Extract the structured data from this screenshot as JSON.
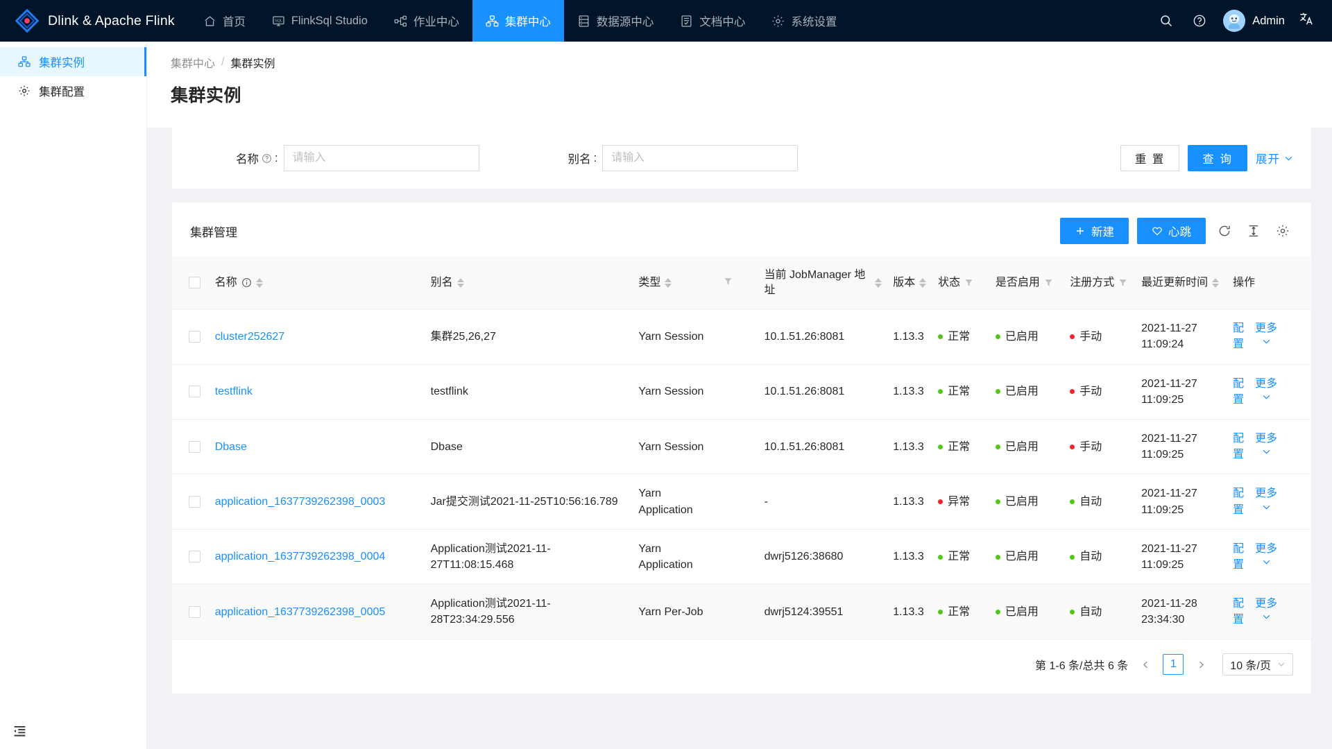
{
  "header": {
    "brand": "Dlink & Apache Flink",
    "logo_icon": "dlink-diamond-logo",
    "nav": [
      {
        "label": "首页",
        "icon": "home-icon",
        "active": false
      },
      {
        "label": "FlinkSql Studio",
        "icon": "sql-monitor-icon",
        "active": false
      },
      {
        "label": "作业中心",
        "icon": "job-node-icon",
        "active": false
      },
      {
        "label": "集群中心",
        "icon": "cluster-icon",
        "active": true
      },
      {
        "label": "数据源中心",
        "icon": "database-icon",
        "active": false
      },
      {
        "label": "文档中心",
        "icon": "document-icon",
        "active": false
      },
      {
        "label": "系统设置",
        "icon": "gear-icon",
        "active": false
      }
    ],
    "tools": [
      {
        "name": "search-icon"
      },
      {
        "name": "help-circle-icon"
      }
    ],
    "user": "Admin",
    "language_icon": "translate-icon",
    "accent": "#1890ff",
    "background": "#001529"
  },
  "sidebar": {
    "items": [
      {
        "label": "集群实例",
        "icon": "cluster-icon",
        "active": true
      },
      {
        "label": "集群配置",
        "icon": "gear-icon",
        "active": false
      }
    ],
    "collapse_icon": "menu-fold-icon"
  },
  "breadcrumb": {
    "root": "集群中心",
    "separator": "/",
    "current": "集群实例"
  },
  "page": {
    "title": "集群实例"
  },
  "filter": {
    "name_label": "名称",
    "name_help_icon": "question-circle-icon",
    "name_colon": ":",
    "name_value": "",
    "name_placeholder": "请输入",
    "alias_label": "别名",
    "alias_colon": ":",
    "alias_value": "",
    "alias_placeholder": "请输入",
    "reset_label": "重 置",
    "search_label": "查 询",
    "expand_label": "展开",
    "expand_icon": "chevron-down-icon"
  },
  "table": {
    "title": "集群管理",
    "toolbar": {
      "create_label": "新建",
      "create_icon": "plus-icon",
      "heartbeat_label": "心跳",
      "heartbeat_icon": "heart-icon",
      "refresh_icon": "reload-icon",
      "density_icon": "column-height-icon",
      "settings_icon": "gear-icon"
    },
    "columns": [
      {
        "key": "check",
        "label": "",
        "sortable": false,
        "filterable": false
      },
      {
        "key": "name",
        "label": "名称",
        "info_icon": "info-circle-icon",
        "sortable": true,
        "filterable": false
      },
      {
        "key": "alias",
        "label": "别名",
        "sortable": true,
        "filterable": false
      },
      {
        "key": "type",
        "label": "类型",
        "sortable": true,
        "filterable": true
      },
      {
        "key": "jm",
        "label": "当前 JobManager 地址",
        "sortable": true,
        "filterable": false
      },
      {
        "key": "ver",
        "label": "版本",
        "sortable": true,
        "filterable": false
      },
      {
        "key": "status",
        "label": "状态",
        "sortable": false,
        "filterable": true
      },
      {
        "key": "enable",
        "label": "是否启用",
        "sortable": false,
        "filterable": true
      },
      {
        "key": "reg",
        "label": "注册方式",
        "sortable": false,
        "filterable": true
      },
      {
        "key": "updated",
        "label": "最近更新时间",
        "sortable": true,
        "filterable": false
      },
      {
        "key": "ops",
        "label": "操作",
        "sortable": false,
        "filterable": false
      }
    ],
    "rows": [
      {
        "name": "cluster252627",
        "alias": "集群25,26,27",
        "type": "Yarn Session",
        "jm": "10.1.51.26:8081",
        "ver": "1.13.3",
        "status": "正常",
        "status_color": "#52c41a",
        "enable": "已启用",
        "enable_color": "#52c41a",
        "reg": "手动",
        "reg_color": "#f5222d",
        "updated_date": "2021-11-27",
        "updated_time": "11:09:24",
        "op_config": "配置",
        "op_more": "更多",
        "highlight": false
      },
      {
        "name": "testflink",
        "alias": "testflink",
        "type": "Yarn Session",
        "jm": "10.1.51.26:8081",
        "ver": "1.13.3",
        "status": "正常",
        "status_color": "#52c41a",
        "enable": "已启用",
        "enable_color": "#52c41a",
        "reg": "手动",
        "reg_color": "#f5222d",
        "updated_date": "2021-11-27",
        "updated_time": "11:09:25",
        "op_config": "配置",
        "op_more": "更多",
        "highlight": false
      },
      {
        "name": "Dbase",
        "alias": "Dbase",
        "type": "Yarn Session",
        "jm": "10.1.51.26:8081",
        "ver": "1.13.3",
        "status": "正常",
        "status_color": "#52c41a",
        "enable": "已启用",
        "enable_color": "#52c41a",
        "reg": "手动",
        "reg_color": "#f5222d",
        "updated_date": "2021-11-27",
        "updated_time": "11:09:25",
        "op_config": "配置",
        "op_more": "更多",
        "highlight": false
      },
      {
        "name": "application_1637739262398_0003",
        "alias": "Jar提交测试2021-11-25T10:56:16.789",
        "type": "Yarn Application",
        "jm": "-",
        "ver": "1.13.3",
        "status": "异常",
        "status_color": "#f5222d",
        "enable": "已启用",
        "enable_color": "#52c41a",
        "reg": "自动",
        "reg_color": "#52c41a",
        "updated_date": "2021-11-27",
        "updated_time": "11:09:25",
        "op_config": "配置",
        "op_more": "更多",
        "highlight": false
      },
      {
        "name": "application_1637739262398_0004",
        "alias": "Application测试2021-11-27T11:08:15.468",
        "type": "Yarn Application",
        "jm": "dwrj5126:38680",
        "ver": "1.13.3",
        "status": "正常",
        "status_color": "#52c41a",
        "enable": "已启用",
        "enable_color": "#52c41a",
        "reg": "自动",
        "reg_color": "#52c41a",
        "updated_date": "2021-11-27",
        "updated_time": "11:09:25",
        "op_config": "配置",
        "op_more": "更多",
        "highlight": false
      },
      {
        "name": "application_1637739262398_0005",
        "alias": "Application测试2021-11-28T23:34:29.556",
        "type": "Yarn Per-Job",
        "jm": "dwrj5124:39551",
        "ver": "1.13.3",
        "status": "正常",
        "status_color": "#52c41a",
        "enable": "已启用",
        "enable_color": "#52c41a",
        "reg": "自动",
        "reg_color": "#52c41a",
        "updated_date": "2021-11-28",
        "updated_time": "23:34:30",
        "op_config": "配置",
        "op_more": "更多",
        "highlight": true
      }
    ],
    "pagination": {
      "summary": "第 1-6 条/总共 6 条",
      "prev_icon": "chevron-left-icon",
      "current_page": "1",
      "next_icon": "chevron-right-icon",
      "page_size": "10 条/页",
      "page_size_icon": "chevron-down-icon"
    }
  }
}
